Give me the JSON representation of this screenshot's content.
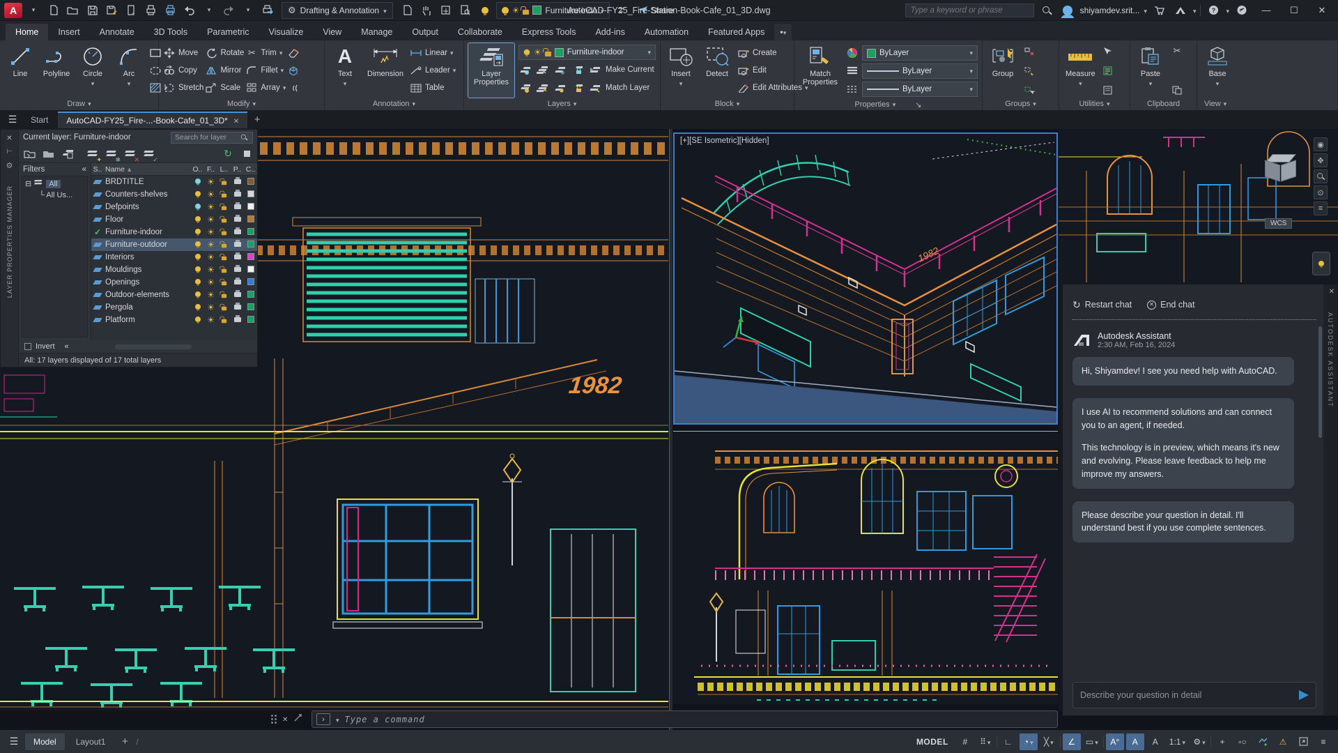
{
  "titlebar": {
    "workspace": "Drafting & Annotation",
    "layer_quick": "Furniture-indo",
    "share": "Share",
    "doc_title": "AutoCAD-FY25_Fire-Station-Book-Cafe_01_3D.dwg",
    "search_placeholder": "Type a keyword or phrase",
    "user": "shiyamdev.srit..."
  },
  "ribbon_tabs": {
    "active": "Home",
    "items": [
      "Home",
      "Insert",
      "Annotate",
      "3D Tools",
      "Parametric",
      "Visualize",
      "View",
      "Manage",
      "Output",
      "Collaborate",
      "Express Tools",
      "Add-ins",
      "Automation",
      "Featured Apps"
    ]
  },
  "ribbon": {
    "draw": {
      "label": "Draw",
      "line": "Line",
      "polyline": "Polyline",
      "circle": "Circle",
      "arc": "Arc"
    },
    "modify": {
      "label": "Modify",
      "move": "Move",
      "rotate": "Rotate",
      "trim": "Trim",
      "copy": "Copy",
      "mirror": "Mirror",
      "fillet": "Fillet",
      "stretch": "Stretch",
      "scale": "Scale",
      "array": "Array"
    },
    "annotation": {
      "label": "Annotation",
      "text": "Text",
      "dimension": "Dimension",
      "linear": "Linear",
      "leader": "Leader",
      "table": "Table"
    },
    "layers": {
      "label": "Layers",
      "layer_properties": "Layer Properties",
      "dropdown_value": "Furniture-indoor",
      "make_current": "Make Current",
      "match_layer": "Match Layer"
    },
    "block": {
      "label": "Block",
      "insert": "Insert",
      "detect": "Detect",
      "create": "Create",
      "edit": "Edit",
      "edit_attributes": "Edit Attributes"
    },
    "properties": {
      "label": "Properties",
      "match_properties": "Match Properties",
      "color": "ByLayer",
      "lineweight": "ByLayer",
      "linetype": "ByLayer"
    },
    "groups": {
      "label": "Groups",
      "group": "Group"
    },
    "utilities": {
      "label": "Utilities",
      "measure": "Measure"
    },
    "clipboard": {
      "label": "Clipboard",
      "paste": "Paste"
    },
    "view": {
      "label": "View",
      "base": "Base"
    }
  },
  "file_tabs": {
    "start": "Start",
    "document": "AutoCAD-FY25_Fire-...-Book-Cafe_01_3D*"
  },
  "layer_palette": {
    "title_vertical": "LAYER PROPERTIES MANAGER",
    "current_layer": "Current layer: Furniture-indoor",
    "search_placeholder": "Search for layer",
    "filters_label": "Filters",
    "tree_all": "All",
    "tree_all_used": "All Us...",
    "columns": {
      "s": "S..",
      "name": "Name",
      "on": "O..",
      "freeze": "F..",
      "lock": "L..",
      "plot": "P..",
      "color": "C.."
    },
    "invert_label": "Invert",
    "status": "All: 17 layers displayed of 17 total layers",
    "bulb_on_color": "#e8bd43",
    "bulb_off_color": "#7fd4e0",
    "layers": [
      {
        "name": "BRDTITLE",
        "on": false,
        "bulb_color": "#7fd4e0",
        "color": "#8a5a2b"
      },
      {
        "name": "Counters-shelves",
        "on": true,
        "bulb_color": "#e8bd43",
        "color": "#d8d8d8"
      },
      {
        "name": "Defpoints",
        "on": false,
        "bulb_color": "#7fd4e0",
        "color": "#f0f0f0"
      },
      {
        "name": "Floor",
        "on": true,
        "bulb_color": "#e8bd43",
        "color": "#bd7a2e"
      },
      {
        "name": "Furniture-indoor",
        "on": true,
        "current": true,
        "bulb_color": "#e8bd43",
        "color": "#17a35f"
      },
      {
        "name": "Furniture-outdoor",
        "on": true,
        "selected": true,
        "bulb_color": "#e8bd43",
        "color": "#17a35f"
      },
      {
        "name": "Interiors",
        "on": true,
        "bulb_color": "#e8bd43",
        "color": "#df3fd0"
      },
      {
        "name": "Mouldings",
        "on": true,
        "bulb_color": "#e8bd43",
        "color": "#f0f0f0"
      },
      {
        "name": "Openings",
        "on": true,
        "bulb_color": "#e8bd43",
        "color": "#2f7de0"
      },
      {
        "name": "Outdoor-elements",
        "on": true,
        "bulb_color": "#e8bd43",
        "color": "#17a35f"
      },
      {
        "name": "Pergola",
        "on": true,
        "bulb_color": "#e8bd43",
        "color": "#17a35f"
      },
      {
        "name": "Platform",
        "on": true,
        "bulb_color": "#e8bd43",
        "color": "#17a35f"
      }
    ]
  },
  "viewport": {
    "iso_label": "[+][SE Isometric][Hidden]",
    "wcs": "WCS",
    "year": "1982"
  },
  "command": {
    "placeholder": "Type  a  command"
  },
  "statusbar": {
    "model_tab": "Model",
    "layout_tab": "Layout1",
    "model_badge": "MODEL",
    "scale": "1:1"
  },
  "assistant": {
    "restart": "Restart chat",
    "end": "End chat",
    "name": "Autodesk Assistant",
    "time": "2:30 AM, Feb 16, 2024",
    "messages": [
      {
        "p1": "Hi, Shiyamdev! I see you need help with AutoCAD."
      },
      {
        "p1": "I use AI to recommend solutions and can connect you to an agent, if needed.",
        "p2": "This technology is in preview, which means it's new and evolving. Please leave feedback to help me improve my answers."
      },
      {
        "p1": "Please describe your question in detail. I'll understand best if you use complete sentences."
      }
    ],
    "input_placeholder": "Describe your question in detail",
    "vertical_label": "AUTODESK ASSISTANT"
  },
  "colors": {
    "accent_blue": "#4a90d9",
    "layer_green": "#17a35f",
    "orange": "#e8913f",
    "teal": "#2fd0ae",
    "magenta": "#d6308f",
    "yellow": "#e8e337"
  }
}
